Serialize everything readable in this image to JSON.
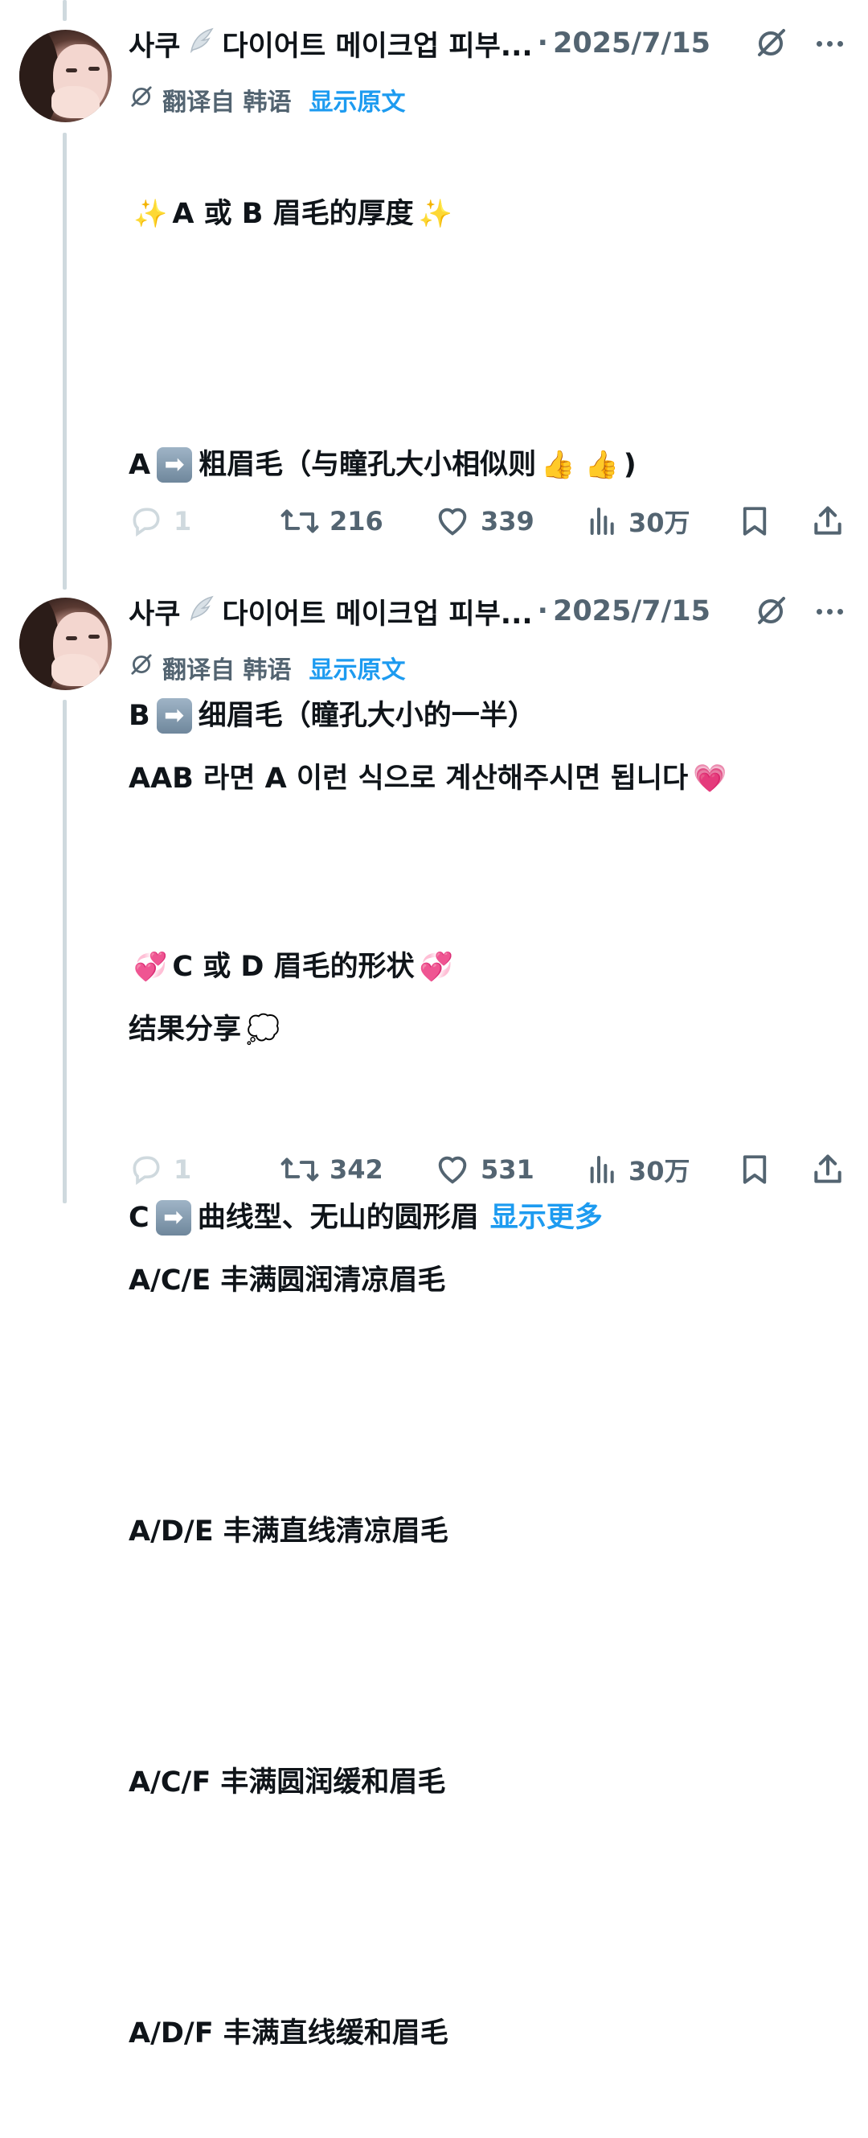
{
  "tweets": [
    {
      "author": "사쿠",
      "author_suffix": "다이어트 메이크업 피부...",
      "separator": "·",
      "date": "2025/7/15",
      "translate": {
        "label": "翻译自 韩语",
        "link": "显示原文"
      },
      "lines": [
        "A 或 B 眉毛的厚度",
        "",
        "A",
        "粗眉毛（与瞳孔大小相似则",
        ")",
        "",
        "B",
        "细眉毛（瞳孔大小的一半）",
        "",
        "C 或 D 眉毛的形状",
        "",
        "C",
        "曲线型、无山的圆形眉"
      ],
      "show_more": "显示更多",
      "counts": {
        "replies": "1",
        "reposts": "216",
        "likes": "339",
        "views": "30万"
      }
    },
    {
      "author": "사쿠",
      "author_suffix": "다이어트 메이크업 피부...",
      "separator": "·",
      "date": "2025/7/15",
      "translate": {
        "label": "翻译自 韩语",
        "link": "显示原文"
      },
      "lines": [
        "AAB 라면 A 이런 식으로 계산해주시면 됩니다",
        "结果分享",
        "A/C/E 丰满圆润清凉眉毛",
        "A/D/E 丰满直线清凉眉毛",
        "A/C/F 丰满圆润缓和眉毛",
        "A/D/F 丰满直线缓和眉毛"
      ],
      "counts": {
        "replies": "1",
        "reposts": "342",
        "likes": "531",
        "views": "30万"
      }
    }
  ],
  "icons": {
    "wing": "wing-icon",
    "grok": "grok-icon",
    "more": "more-icon",
    "reply": "reply-icon",
    "repost": "repost-icon",
    "like": "heart-icon",
    "views": "views-icon",
    "bookmark": "bookmark-icon",
    "share": "share-icon"
  },
  "colors": {
    "link": "#1d9bf0",
    "secondary": "#536471",
    "thread_line": "#cfd9de"
  }
}
